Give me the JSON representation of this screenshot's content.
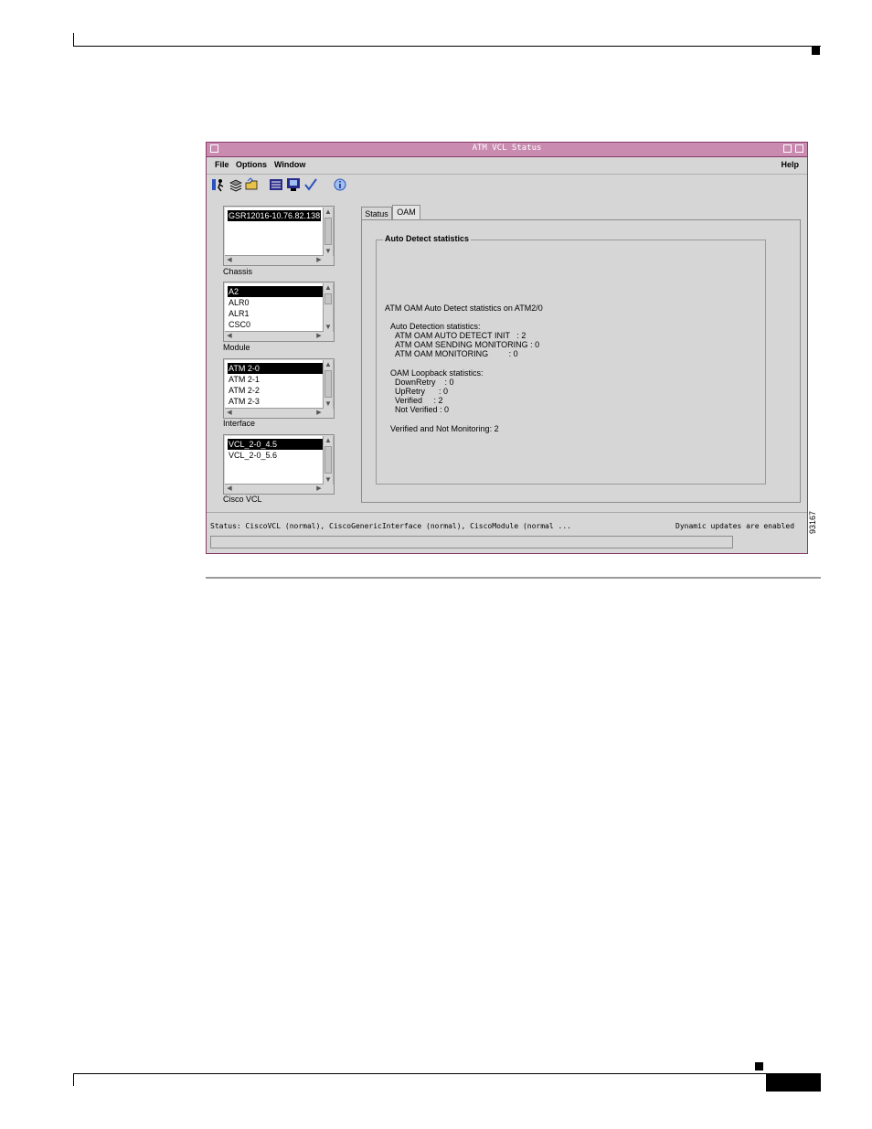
{
  "window": {
    "title": "ATM VCL Status",
    "menus": [
      "File",
      "Options",
      "Window"
    ],
    "help_menu": "Help",
    "toolbar_icons": [
      "user-run-icon",
      "layers-icon",
      "folder-open-icon",
      "list-icon",
      "monitor-icon",
      "checkmark-icon",
      "info-icon"
    ]
  },
  "chassis": {
    "label": "Chassis",
    "items": [
      "GSR12016-10.76.82.138"
    ],
    "selected": 0
  },
  "module": {
    "label": "Module",
    "items": [
      "A2",
      "ALR0",
      "ALR1",
      "CSC0"
    ],
    "selected": 0
  },
  "interface": {
    "label": "Interface",
    "items": [
      "ATM 2-0",
      "ATM 2-1",
      "ATM 2-2",
      "ATM 2-3"
    ],
    "selected": 0
  },
  "cisco_vcl": {
    "label": "Cisco VCL",
    "items": [
      "VCL_2-0_4.5",
      "VCL_2-0_5.6"
    ],
    "selected": 0
  },
  "tabs": [
    {
      "label": "Status",
      "active": false
    },
    {
      "label": "OAM",
      "active": true
    }
  ],
  "oam": {
    "group_title": "Auto Detect statistics",
    "heading": "ATM OAM Auto Detect statistics on ATM2/0",
    "auto_detection_title": "Auto Detection statistics:",
    "auto_detection": [
      "ATM OAM AUTO DETECT INIT   : 2",
      "ATM OAM SENDING MONITORING : 0",
      "ATM OAM MONITORING         : 0"
    ],
    "loopback_title": "OAM Loopback statistics:",
    "loopback": [
      "DownRetry    : 0",
      "UpRetry      : 0",
      "Verified     : 2",
      "Not Verified : 0"
    ],
    "summary": "Verified and Not Monitoring: 2"
  },
  "status": {
    "text": "Status: CiscoVCL (normal), CiscoGenericInterface (normal), CiscoModule (normal ...",
    "dynamic": "Dynamic updates are enabled"
  },
  "figure_number": "93167"
}
